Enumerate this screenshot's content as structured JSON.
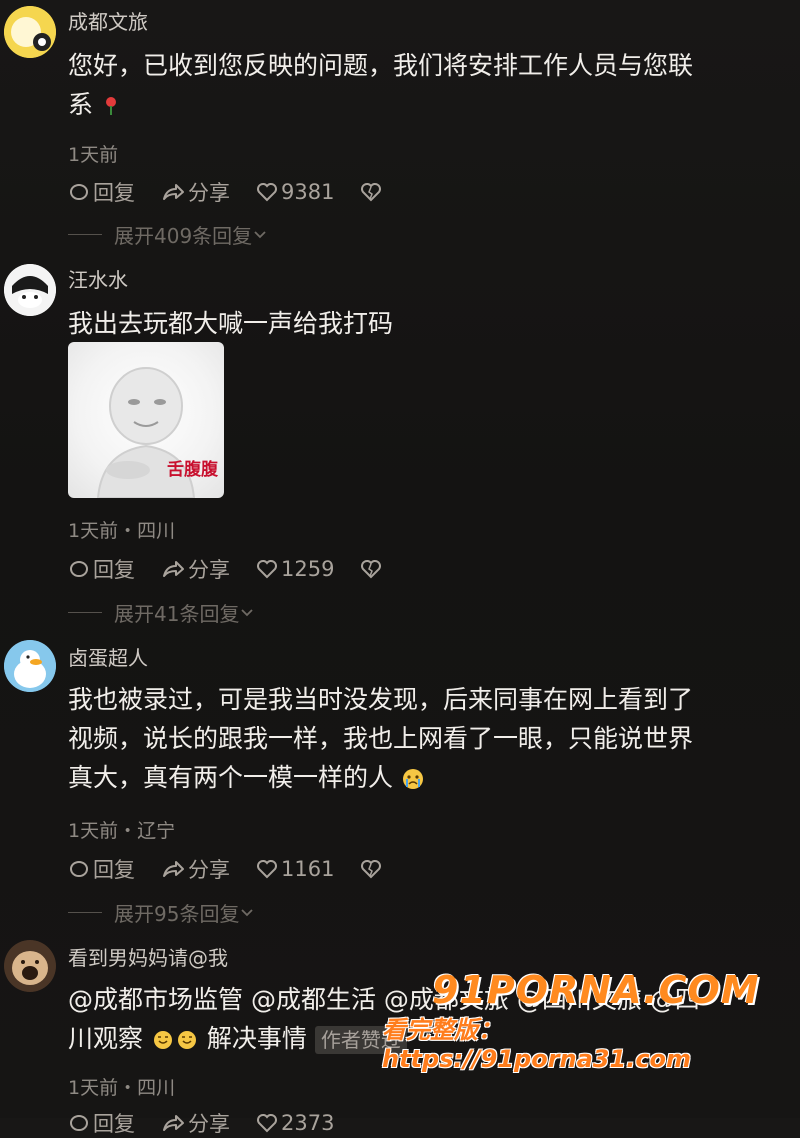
{
  "comments": [
    {
      "username": "成都文旅",
      "text_line1": "您好，已收到您反映的问题，我们将安排工作人员与您联",
      "text_line2": "系",
      "inline_emoji": "rose-emoji",
      "meta": "1天前",
      "reply": "回复",
      "share": "分享",
      "likes": "9381",
      "expand": "展开409条回复"
    },
    {
      "username": "汪水水",
      "text": "我出去玩都大喊一声给我打码",
      "sticker_caption": "舌腹腹",
      "meta": "1天前・四川",
      "reply": "回复",
      "share": "分享",
      "likes": "1259",
      "expand": "展开41条回复"
    },
    {
      "username": "卤蛋超人",
      "text_line1": "我也被录过，可是我当时没发现，后来同事在网上看到了",
      "text_line2": "视频，说长的跟我一样，我也上网看了一眼，只能说世界",
      "text_line3": "真大，真有两个一模一样的人",
      "inline_emoji": "crying-emoji",
      "meta": "1天前・辽宁",
      "reply": "回复",
      "share": "分享",
      "likes": "1161",
      "expand": "展开95条回复"
    },
    {
      "username": "看到男妈妈请@我",
      "text_line1": "@成都市场监管 @成都生活 @成都文旅 @四川文旅 @四",
      "text_line2_a": "川观察",
      "text_line2_b": "解决事情",
      "author_tag": "作者赞过",
      "meta": "1天前・四川",
      "reply": "回复",
      "share": "分享",
      "likes": "2373"
    }
  ],
  "watermark": {
    "line1": "91PORNA.COM",
    "line2": "看完整版：https://91porna31.com"
  },
  "colors": {
    "background": "#151413",
    "text": "#f1eeea",
    "meta": "#8f8a84",
    "watermark": "#ff8a1f"
  }
}
